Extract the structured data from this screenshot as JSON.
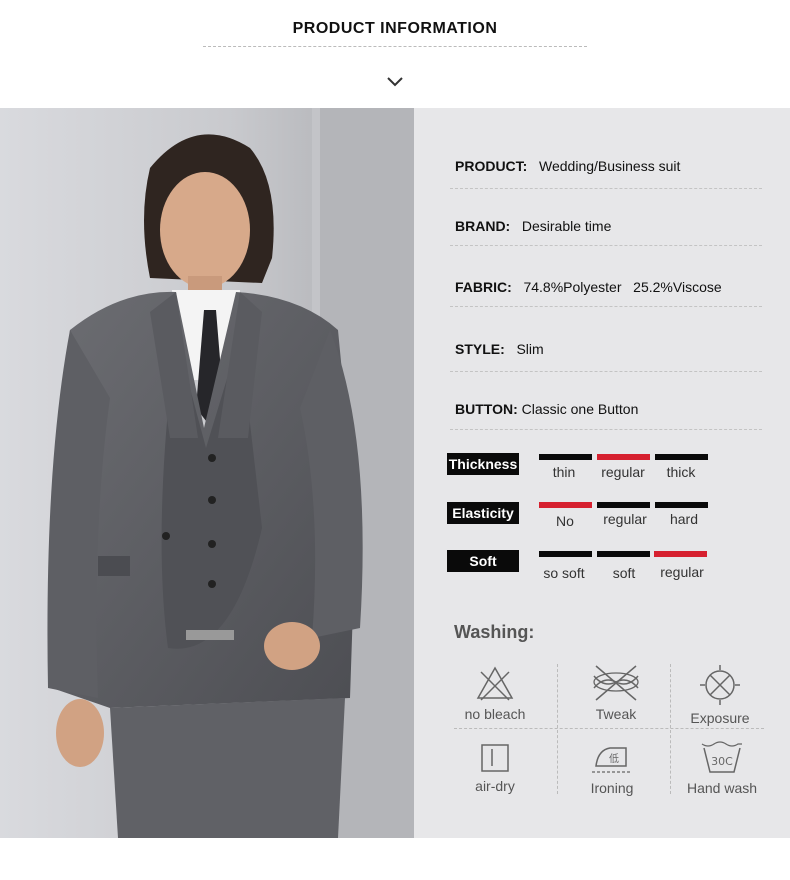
{
  "header": {
    "title": "PRODUCT INFORMATION"
  },
  "specs": [
    {
      "label": "PRODUCT:",
      "value": "Wedding/Business suit"
    },
    {
      "label": "BRAND:",
      "value": "Desirable time"
    },
    {
      "label": "FABRIC:",
      "value": "74.8%Polyester   25.2%Viscose"
    },
    {
      "label": "STYLE:",
      "value": "Slim"
    },
    {
      "label": "BUTTON:",
      "value": "Classic one Button"
    }
  ],
  "scales": [
    {
      "label": "Thickness",
      "options": [
        "thin",
        "regular",
        "thick"
      ],
      "selected": "regular"
    },
    {
      "label": "Elasticity",
      "options": [
        "No",
        "regular",
        "hard"
      ],
      "selected": "No"
    },
    {
      "label": "Soft",
      "options": [
        "so soft",
        "soft",
        "regular"
      ],
      "selected": "regular"
    }
  ],
  "colors": {
    "selected": "#d6202f",
    "unselected": "#0a0a0a",
    "panel": "#e7e7e9"
  },
  "washing": {
    "title": "Washing:",
    "items": [
      {
        "label": "no bleach",
        "icon": "no-bleach-icon"
      },
      {
        "label": "Tweak",
        "icon": "no-wring-icon"
      },
      {
        "label": "Exposure",
        "icon": "no-sun-exposure-icon"
      },
      {
        "label": "air-dry",
        "icon": "air-dry-icon"
      },
      {
        "label": "Ironing",
        "icon": "iron-low-icon",
        "icon_text": "低"
      },
      {
        "label": "Hand wash",
        "icon": "hand-wash-icon",
        "icon_text": "30C"
      }
    ]
  }
}
